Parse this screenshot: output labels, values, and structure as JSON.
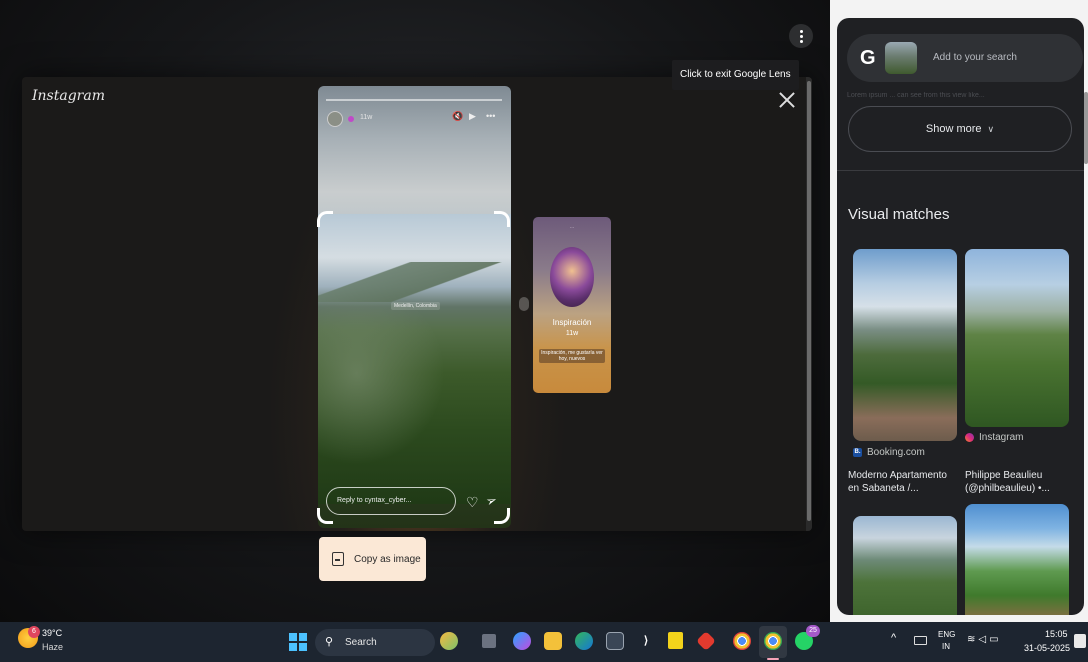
{
  "lens": {
    "exit_tooltip": "Click to exit Google Lens",
    "copy_button_label": "Copy as image"
  },
  "instagram": {
    "logo_text": "Instagram",
    "story": {
      "time": "11w",
      "location": "Medellín, Colombia",
      "reply_placeholder": "Reply to cyntax_cyber..."
    },
    "next_story": {
      "name": "Inspiración",
      "time": "11w",
      "caption": "Inspiración, me gustaría ver hoy, nuevos"
    }
  },
  "side_panel": {
    "search_placeholder": "Add to your search",
    "faded_text": "Lorem ipsum ... can see from this view like...",
    "show_more_label": "Show more",
    "section_title": "Visual matches",
    "matches": [
      {
        "source": "Booking.com",
        "title": "Moderno Apartamento en Sabaneta /..."
      },
      {
        "source": "Instagram",
        "title": "Philippe Beaulieu (@philbeaulieu) •..."
      }
    ]
  },
  "taskbar": {
    "weather_temp": "39°C",
    "weather_condition": "Haze",
    "weather_badge": "6",
    "search_label": "Search",
    "whatsapp_badge": "25",
    "lang_top": "ENG",
    "lang_bottom": "IN",
    "time": "15:05",
    "date": "31-05-2025"
  },
  "colors": {
    "copy_button_bg": "#fbe8d6",
    "side_panel_bg": "#1f2023",
    "taskbar_bg": "#1d2530"
  }
}
